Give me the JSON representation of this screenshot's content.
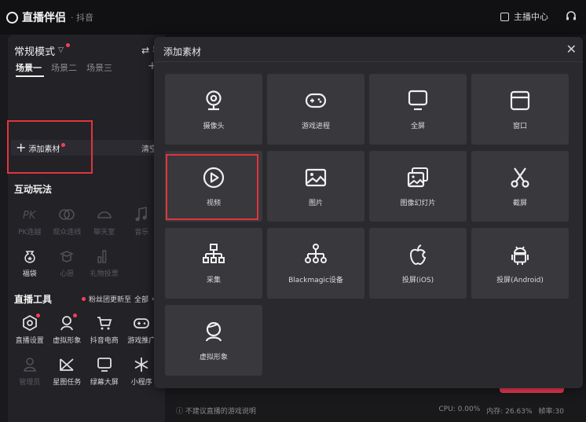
{
  "app": {
    "brand": "直播伴侣",
    "platform": "· 抖音",
    "anchor_center": "主播中心"
  },
  "left": {
    "mode": "常规模式",
    "guide": "⇄ 导播",
    "scenes": [
      "场景一",
      "场景二",
      "场景三"
    ],
    "add_material": "添加素材",
    "clear": "清空",
    "interactive_title": "互动玩法",
    "interactive": [
      {
        "label": "PK连越",
        "icon": "pk-icon",
        "dim": true
      },
      {
        "label": "观众连线",
        "icon": "link-icon",
        "dim": true
      },
      {
        "label": "聊天室",
        "icon": "chat-room-icon",
        "dim": true
      },
      {
        "label": "音乐",
        "icon": "music-icon",
        "dim": true
      },
      {
        "label": "福袋",
        "icon": "lucky-bag-icon",
        "dim": false
      },
      {
        "label": "心愿",
        "icon": "wish-icon",
        "dim": true
      },
      {
        "label": "礼物投票",
        "icon": "vote-icon",
        "dim": true
      }
    ],
    "tools_title": "直播工具",
    "fans_update": "粉丝团更新至",
    "all": "全部",
    "tools": [
      {
        "label": "直播设置",
        "icon": "settings-icon",
        "dim": false,
        "dot": true
      },
      {
        "label": "虚拟形象",
        "icon": "avatar-icon",
        "dim": false,
        "dot": true
      },
      {
        "label": "抖音电商",
        "icon": "cart-icon",
        "dim": false,
        "dot": false
      },
      {
        "label": "游戏推广",
        "icon": "gamepad-icon",
        "dim": false,
        "dot": false
      },
      {
        "label": "管理员",
        "icon": "admin-icon",
        "dim": true,
        "dot": false
      },
      {
        "label": "星图任务",
        "icon": "star-task-icon",
        "dim": false,
        "dot": false
      },
      {
        "label": "绿幕大屏",
        "icon": "monitor-icon",
        "dim": false,
        "dot": false
      },
      {
        "label": "小程序",
        "icon": "mini-program-icon",
        "dim": false,
        "dot": false
      }
    ]
  },
  "modal": {
    "title": "添加素材",
    "tiles": [
      {
        "label": "摄像头",
        "icon": "camera-icon"
      },
      {
        "label": "游戏进程",
        "icon": "game-process-icon"
      },
      {
        "label": "全屏",
        "icon": "fullscreen-monitor-icon"
      },
      {
        "label": "窗口",
        "icon": "window-icon"
      },
      {
        "label": "视频",
        "icon": "video-play-icon"
      },
      {
        "label": "图片",
        "icon": "image-icon"
      },
      {
        "label": "图像幻灯片",
        "icon": "slideshow-icon"
      },
      {
        "label": "截屏",
        "icon": "scissors-icon"
      },
      {
        "label": "采集",
        "icon": "capture-network-icon"
      },
      {
        "label": "Blackmagic设备",
        "icon": "blackmagic-network-icon"
      },
      {
        "label": "投屏(iOS)",
        "icon": "apple-icon"
      },
      {
        "label": "投屏(Android)",
        "icon": "android-icon"
      },
      {
        "label": "虚拟形象",
        "icon": "virtual-avatar-icon"
      }
    ]
  },
  "status": {
    "notice": "不建议直播的游戏说明",
    "cpu": "CPU: 0.00%",
    "memory": "内存: 26.63%",
    "fps": "帧率:30"
  },
  "colors": {
    "accent_red": "#e2343d",
    "dot_red": "#ff3b5c",
    "modal_bg": "#2a2a2e",
    "tile_bg": "#38383d"
  }
}
